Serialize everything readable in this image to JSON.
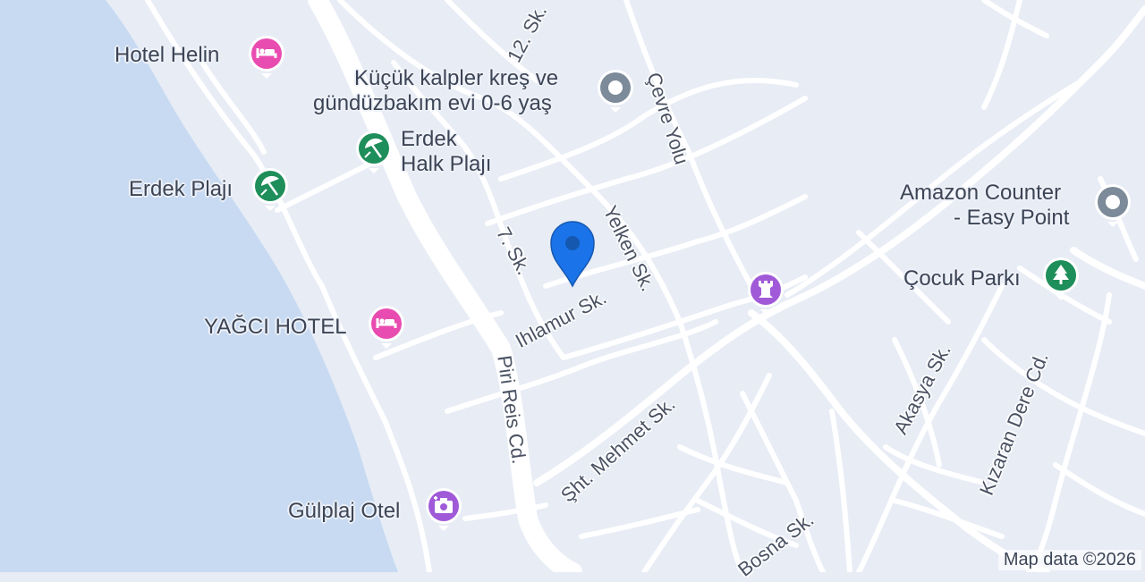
{
  "map": {
    "colors": {
      "water": "#c7daf2",
      "land": "#e8ecf5",
      "road": "#ffffff",
      "location_pin": "#1a73e8"
    },
    "attribution": "Map data ©2026"
  },
  "places": [
    {
      "name": "Hotel Helin",
      "icon": "hotel-icon",
      "color": "#e94cb0"
    },
    {
      "name": "Küçük kalpler kreş ve",
      "name2": "gündüzbakım evi 0-6 yaş",
      "icon": "generic-place-icon",
      "color": "#7c8a99"
    },
    {
      "name": "Erdek",
      "name2": "Halk Plajı",
      "icon": "beach-icon",
      "color": "#1e8e5a"
    },
    {
      "name": "Erdek Plajı",
      "icon": "beach-icon",
      "color": "#1e8e5a"
    },
    {
      "name": "Amazon Counter",
      "name2": "- Easy Point",
      "icon": "generic-place-icon",
      "color": "#7c8a99"
    },
    {
      "name": "Çocuk Parkı",
      "icon": "park-tree-icon",
      "color": "#1e8e5a"
    },
    {
      "name": "YAĞCI HOTEL",
      "icon": "hotel-icon",
      "color": "#e94cb0"
    },
    {
      "name": "Gülplaj Otel",
      "icon": "camera-icon",
      "color": "#a05ad8"
    },
    {
      "name": "",
      "icon": "museum-icon",
      "color": "#a05ad8"
    }
  ],
  "streets": [
    "12. Sk.",
    "Çevre Yolu",
    "Yelken Sk.",
    "7. Sk.",
    "Ihlamur Sk.",
    "Piri Reis Cd.",
    "Şht. Mehmet Sk.",
    "Akasya Sk.",
    "Kızaran Dere Cd.",
    "Bosna Sk."
  ]
}
